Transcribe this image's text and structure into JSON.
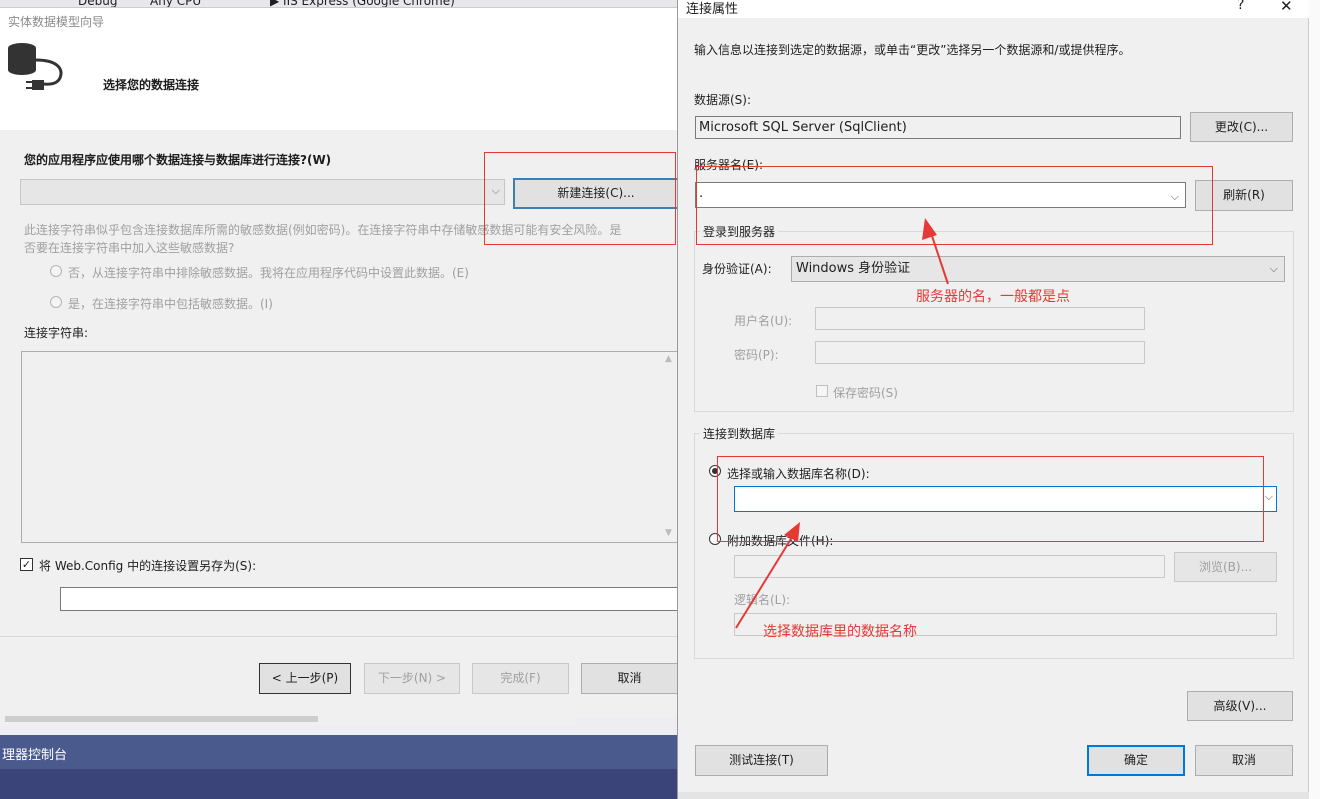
{
  "background": {
    "toolbar_items": [
      "Debug",
      "Any CPU",
      "IIS Express (Google Chrome)"
    ],
    "panel_title": "理器控制台"
  },
  "wizard": {
    "title": "实体数据模型向导",
    "heading": "选择您的数据连接",
    "question": "您的应用程序应使用哪个数据连接与数据库进行连接?(W)",
    "new_connection_label": "新建连接(C)...",
    "sensitive_line1": "此连接字符串似乎包含连接数据库所需的敏感数据(例如密码)。在连接字符串中存储敏感数据可能有安全风险。是",
    "sensitive_line2": "否要在连接字符串中加入这些敏感数据?",
    "option_no": "否，从连接字符串中排除敏感数据。我将在应用程序代码中设置此数据。(E)",
    "option_yes": "是，在连接字符串中包括敏感数据。(I)",
    "connstr_label": "连接字符串:",
    "save_config_checked": true,
    "save_config_label": "将 Web.Config 中的连接设置另存为(S):",
    "back_label": "< 上一步(P)",
    "next_label": "下一步(N) >",
    "finish_label": "完成(F)",
    "cancel_label": "取消"
  },
  "props": {
    "title": "连接属性",
    "help": "?",
    "close": "✕",
    "intro": "输入信息以连接到选定的数据源，或单击“更改”选择另一个数据源和/或提供程序。",
    "datasource_label": "数据源(S):",
    "datasource_value": "Microsoft SQL Server (SqlClient)",
    "change_label": "更改(C)...",
    "server_label": "服务器名(E):",
    "server_value": ".",
    "refresh_label": "刷新(R)",
    "login_group": "登录到服务器",
    "auth_label": "身份验证(A):",
    "auth_value": "Windows 身份验证",
    "username_label": "用户名(U):",
    "password_label": "密码(P):",
    "save_password_label": "保存密码(S)",
    "db_group": "连接到数据库",
    "select_db_label": "选择或输入数据库名称(D):",
    "attach_db_label": "附加数据库文件(H):",
    "browse_label": "浏览(B)...",
    "logical_label": "逻辑名(L):",
    "advanced_label": "高级(V)...",
    "test_label": "测试连接(T)",
    "ok_label": "确定",
    "cancel_label": "取消"
  },
  "annotations": {
    "server_note": "服务器的名，一般都是点",
    "db_note": "选择数据库里的数据名称",
    "color": "#e53935"
  }
}
